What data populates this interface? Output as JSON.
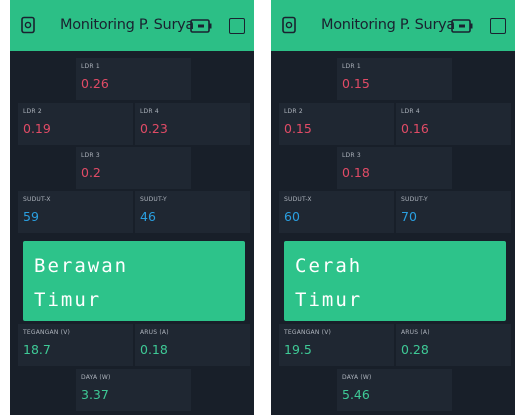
{
  "panels": [
    {
      "header": {
        "title": "Monitoring P. Surya",
        "device_icon": "device-icon",
        "battery_icon": "battery-icon",
        "square_icon": "square-icon"
      },
      "ldr1": {
        "label": "LDR 1",
        "value": "0.26"
      },
      "ldr2": {
        "label": "LDR 2",
        "value": "0.19"
      },
      "ldr4": {
        "label": "LDR 4",
        "value": "0.23"
      },
      "ldr3": {
        "label": "LDR 3",
        "value": "0.2"
      },
      "sudut_x": {
        "label": "SUDUT-X",
        "value": "59"
      },
      "sudut_y": {
        "label": "SUDUT-Y",
        "value": "46"
      },
      "lcd": {
        "line1": "Berawan",
        "line2": "Timur"
      },
      "tegangan": {
        "label": "TEGANGAN (V)",
        "value": "18.7"
      },
      "arus": {
        "label": "ARUS (A)",
        "value": "0.18"
      },
      "daya": {
        "label": "DAYA (W)",
        "value": "3.37"
      }
    },
    {
      "header": {
        "title": "Monitoring P. Surya",
        "device_icon": "device-icon",
        "battery_icon": "battery-icon",
        "square_icon": "square-icon"
      },
      "ldr1": {
        "label": "LDR 1",
        "value": "0.15"
      },
      "ldr2": {
        "label": "LDR 2",
        "value": "0.15"
      },
      "ldr4": {
        "label": "LDR 4",
        "value": "0.16"
      },
      "ldr3": {
        "label": "LDR 3",
        "value": "0.18"
      },
      "sudut_x": {
        "label": "SUDUT-X",
        "value": "60"
      },
      "sudut_y": {
        "label": "SUDUT-Y",
        "value": "70"
      },
      "lcd": {
        "line1": "Cerah",
        "line2": "Timur"
      },
      "tegangan": {
        "label": "TEGANGAN (V)",
        "value": "19.5"
      },
      "arus": {
        "label": "ARUS (A)",
        "value": "0.28"
      },
      "daya": {
        "label": "DAYA (W)",
        "value": "5.46"
      }
    }
  ],
  "colors": {
    "header_green": "#2cbf86",
    "background": "#181f29",
    "widget": "#1f2732",
    "ldr_red": "#e14b66",
    "angle_blue": "#2a9fe0",
    "power_green": "#3ec996"
  }
}
